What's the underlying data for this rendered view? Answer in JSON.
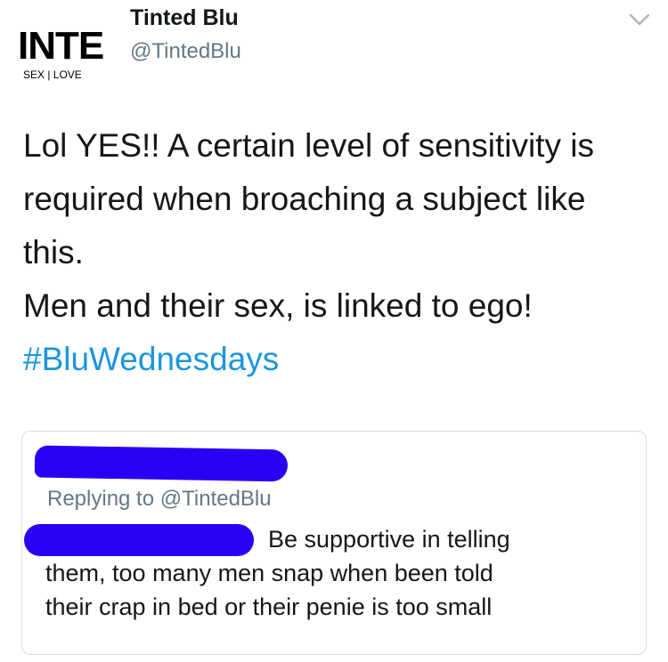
{
  "header": {
    "display_name": "Tinted Blu",
    "handle": "@TintedBlu",
    "avatar_logo_text": "INTE",
    "avatar_logo_sub": "SEX | LOVE"
  },
  "tweet": {
    "lines": [
      "Lol YES!! A certain level of sensitivity is",
      "required when broaching a subject like",
      "this.",
      "Men and their sex, is linked to ego!"
    ],
    "hashtag": "#BluWednesdays"
  },
  "quoted": {
    "replying_to": "Replying to @TintedBlu",
    "lines": [
      "Be  supportive in telling",
      "them, too many men snap when been told",
      "their crap in bed or their penie is too small"
    ]
  },
  "colors": {
    "link": "#1b95e0",
    "secondary_text": "#657786",
    "redaction": "#2a00f5",
    "border": "#d8dde1"
  },
  "icons": {
    "menu": "chevron-down-icon"
  }
}
